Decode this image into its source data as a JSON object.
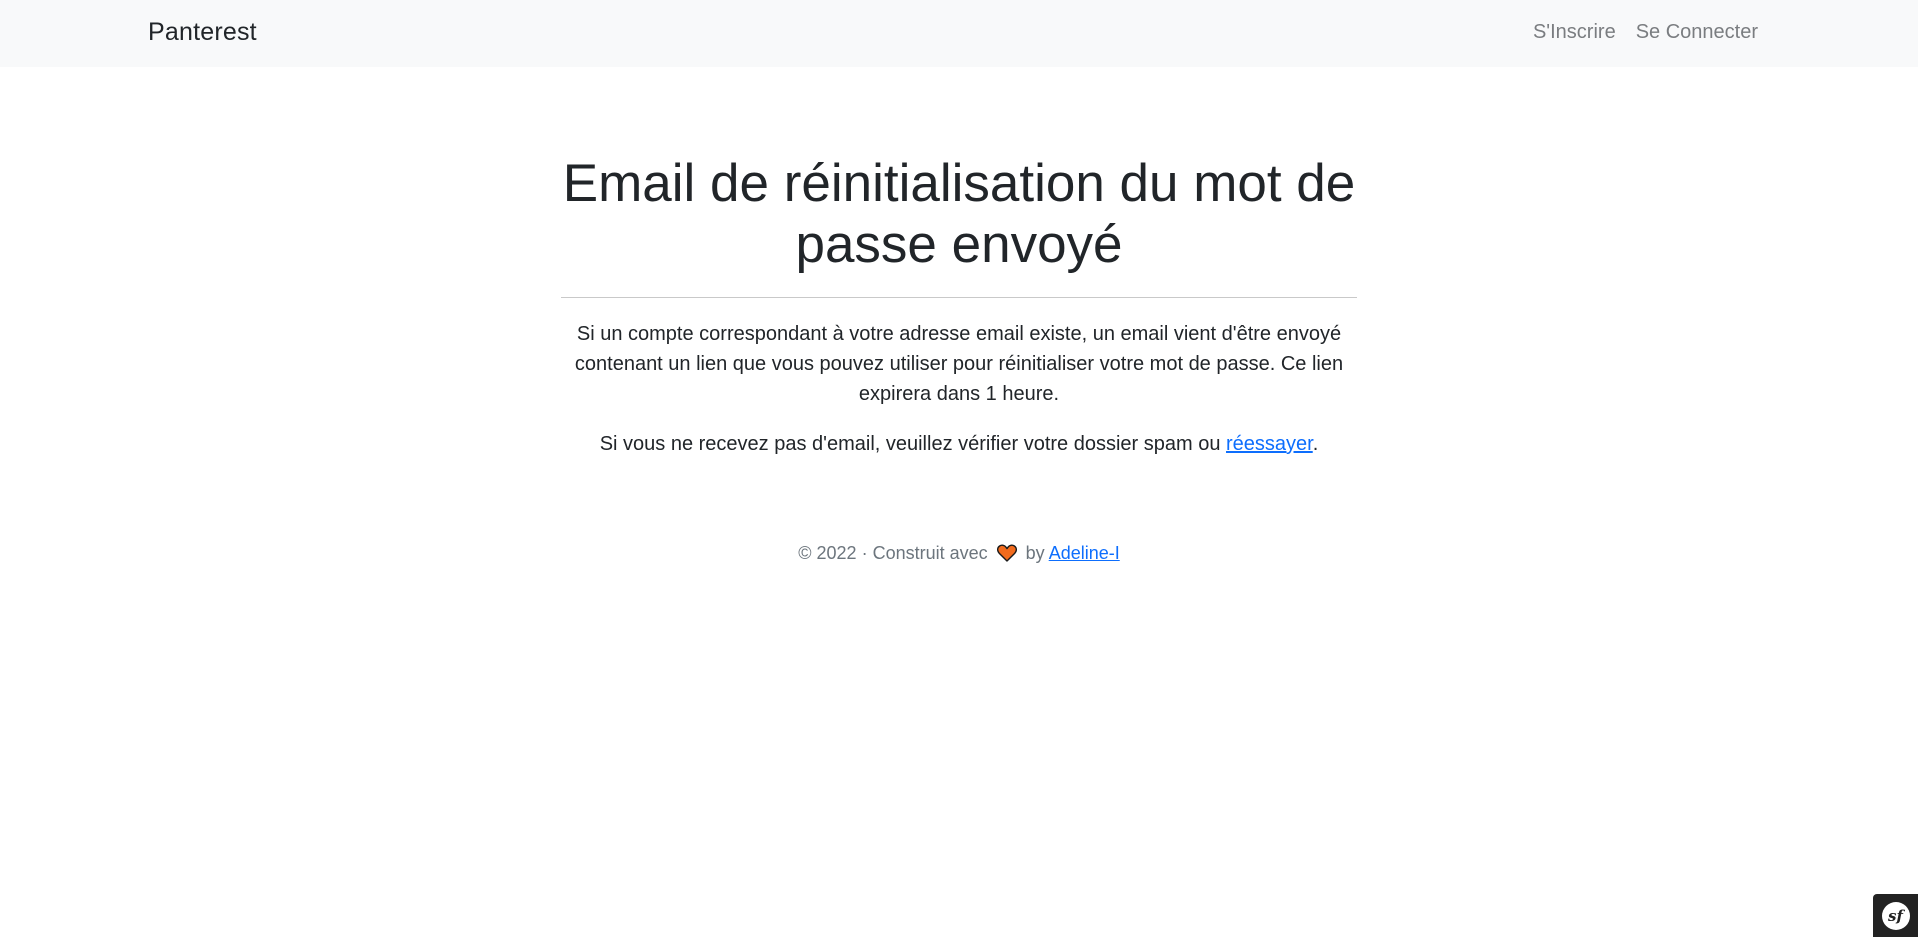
{
  "navbar": {
    "brand": "Panterest",
    "links": [
      {
        "label": "S'Inscrire"
      },
      {
        "label": "Se Connecter"
      }
    ]
  },
  "main": {
    "title": "Email de réinitialisation du mot de passe envoyé",
    "paragraph1": "Si un compte correspondant à votre adresse email existe, un email vient d'être envoyé contenant un lien que vous pouvez utiliser pour réinitialiser votre mot de passe. Ce lien expirera dans 1 heure.",
    "paragraph2_prefix": "Si vous ne recevez pas d'email, veuillez vérifier votre dossier spam ou ",
    "retry_link": "réessayer",
    "paragraph2_suffix": "."
  },
  "footer": {
    "prefix": "© 2022 · Construit avec",
    "heart_icon": "heart-icon",
    "heart_color": "#f26b1d",
    "by": "by",
    "author_link": "Adeline-I"
  },
  "debug_toolbar": {
    "logo_icon": "symfony-logo-icon",
    "logo_text": "sf"
  },
  "colors": {
    "link": "#0d6efd",
    "navbar_bg": "#f8f9fa",
    "nav_link": "#7a7d80"
  }
}
